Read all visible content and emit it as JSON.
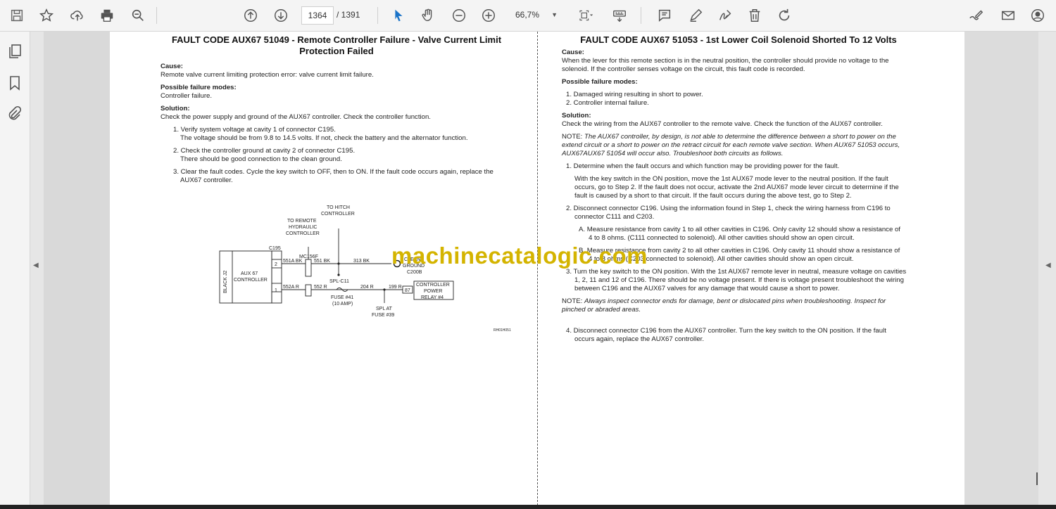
{
  "toolbar": {
    "page_current": "1364",
    "page_total": "/ 1391",
    "zoom": "66,7%"
  },
  "icons": [
    "save-icon",
    "bookmark-star-icon",
    "upload-icon",
    "print-icon",
    "zoom-search-icon",
    "prev-page-icon",
    "next-page-icon",
    "select-cursor-icon",
    "hand-tool-icon",
    "zoom-out-icon",
    "zoom-in-icon",
    "page-fit-icon",
    "keyboard-icon",
    "comment-icon",
    "pen-icon",
    "sign-icon",
    "delete-icon",
    "rotate-icon",
    "edit-pdf-icon",
    "mail-icon",
    "account-icon"
  ],
  "left_page": {
    "title": "FAULT CODE AUX67 51049 - Remote Controller Failure - Valve Current Limit Protection Failed",
    "cause_heading": "Cause:",
    "cause_text": "Remote valve current limiting protection error: valve current limit failure.",
    "modes_heading": "Possible failure modes:",
    "modes_text": "Controller failure.",
    "solution_heading": "Solution:",
    "solution_text": "Check the power supply and ground of the AUX67 controller. Check the controller function.",
    "steps": [
      {
        "line1": "1. Verify system voltage at cavity 1 of connector C195.",
        "line2": "The voltage should be from 9.8 to 14.5 volts. If not, check the battery and the alternator function."
      },
      {
        "line1": "2. Check the controller ground at cavity 2 of connector C195.",
        "line2": "There should be good connection to the clean ground."
      },
      {
        "line1": "3. Clear the fault codes. Cycle the key switch to OFF, then to ON. If the fault code occurs again, replace the",
        "line2": "AUX67 controller."
      }
    ],
    "diagram": {
      "to_hitch": "TO HITCH",
      "controller": "CONTROLLER",
      "to_remote": "TO REMOTE",
      "hydraulic": "HYDRAULIC",
      "controller2": "CONTROLLER",
      "c195": "C195",
      "mc156f": "MC156F",
      "aux67": "AUX 67",
      "controller3": "CONTROLLER",
      "black_j2": "BLACK J2",
      "pin2": "2",
      "pin1": "1",
      "w551a": "551A BK",
      "w551b": "551 BK",
      "w313": "313 BK",
      "w552a": "552A R",
      "w552": "552 R",
      "w204": "204 R",
      "w199": "199 R",
      "pin87": "87",
      "spl_c11": "SPL-C11",
      "clean": "CLEAN",
      "ground": "GROUND",
      "c200b": "C200B",
      "relay1": "CONTROLLER",
      "relay2": "POWER",
      "relay3": "RELAY #4",
      "fuse41": "FUSE #41",
      "amp": "(10 AMP)",
      "spl_at": "SPL AT",
      "fuse39": "FUSE #39",
      "ref": "RH01H051"
    }
  },
  "right_page": {
    "title": "FAULT CODE AUX67 51053 - 1st Lower Coil Solenoid Shorted To 12 Volts",
    "cause_heading": "Cause:",
    "cause_lines": [
      "When the lever for this remote section is in the neutral position, the controller should provide no voltage to the",
      "solenoid. If the controller senses voltage on the circuit, this fault code is recorded."
    ],
    "modes_heading": "Possible failure modes:",
    "modes": [
      "1. Damaged wiring resulting in short to power.",
      "2. Controller internal failure."
    ],
    "solution_heading": "Solution:",
    "solution_text": "Check the wiring from the AUX67 controller to the remote valve. Check the function of the AUX67 controller.",
    "note1_label": "NOTE:",
    "note1_lines": [
      "The AUX67 controller, by design, is not able to determine the difference between a short to power on the",
      "extend circuit or a short to power on the retract circuit for each remote valve section. When AUX67 51053 occurs,",
      "AUX67AUX67 51054 will occur also. Troubleshoot both circuits as follows."
    ],
    "step1": "1. Determine when the fault occurs and which function may be providing power for the fault.",
    "step1_detail": [
      "With the key switch in the ON position, move the 1st AUX67 mode lever to the neutral position. If the fault",
      "occurs, go to Step 2. If the fault does not occur, activate the 2nd AUX67 mode lever circuit to determine if the",
      "fault is caused by a short to that circuit. If the fault occurs during the above test, go to Step 2."
    ],
    "step2": [
      "2. Disconnect connector C196. Using the information found in Step 1, check the wiring harness from C196 to",
      "connector C111 and C203."
    ],
    "step2a": [
      "A. Measure resistance from cavity 1 to all other cavities in C196. Only cavity 12 should show a resistance of",
      "4 to 8 ohms. (C111 connected to solenoid). All other cavities should show an open circuit."
    ],
    "step2b": [
      "B. Measure resistance from cavity 2 to all other cavities in C196. Only cavity 11 should show a resistance of",
      "4 to 8 ohms (C203 connected to solenoid). All other cavities should show an open circuit."
    ],
    "step3": [
      "3. Turn the key switch to the ON position. With the 1st AUX67 remote lever in neutral, measure voltage on cavities",
      "1, 2, 11 and 12 of C196. There should be no voltage present. If there is voltage present troubleshoot the wiring",
      "between C196 and the AUX67 valves for any damage that would cause a short to power."
    ],
    "note2_label": "NOTE:",
    "note2_lines": [
      "Always inspect connector ends for damage, bent or dislocated pins when troubleshooting. Inspect for",
      "pinched or abraded areas."
    ],
    "step4": [
      "4. Disconnect connector C196 from the AUX67 controller. Turn the key switch to the ON position. If the fault",
      "occurs again, replace the AUX67 controller."
    ]
  },
  "watermark": "machinecatalogic.com"
}
